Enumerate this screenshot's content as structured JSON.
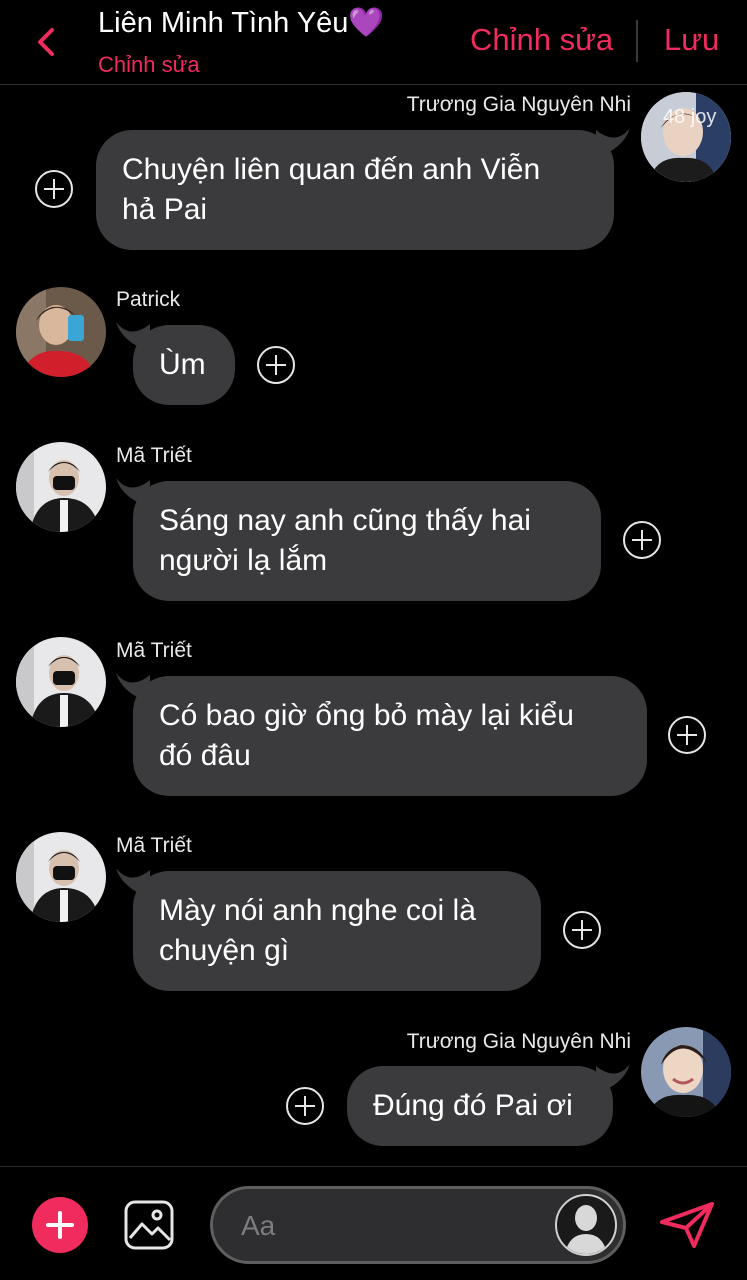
{
  "header": {
    "title": "Liên Minh Tình Yêu💜",
    "subtitle": "Chỉnh sửa",
    "edit_label": "Chỉnh sửa",
    "save_label": "Lưu"
  },
  "messages": [
    {
      "sender": "Trương Gia Nguyên Nhi",
      "side": "right",
      "lines": [
        "Chuyện liên quan đến anh Viễn",
        "hả Pai"
      ],
      "avatar_watermark": "48 joy"
    },
    {
      "sender": "Patrick",
      "side": "left",
      "lines": [
        "Ùm"
      ]
    },
    {
      "sender": "Mã Triết",
      "side": "left",
      "lines": [
        "Sáng nay anh cũng thấy hai",
        "người lạ lắm"
      ]
    },
    {
      "sender": "Mã Triết",
      "side": "left",
      "lines": [
        "Có bao giờ ổng bỏ mày lại kiểu",
        "đó đâu"
      ]
    },
    {
      "sender": "Mã Triết",
      "side": "left",
      "lines": [
        "Mày nói anh nghe coi là",
        "chuyện gì"
      ]
    },
    {
      "sender": "Trương Gia Nguyên Nhi",
      "side": "right",
      "lines": [
        "Đúng đó Pai ơi"
      ]
    }
  ],
  "composer": {
    "placeholder": "Aa"
  },
  "colors": {
    "accent": "#f02b5e",
    "bubble": "#3b3b3d",
    "background": "#000000"
  },
  "icons": [
    "chevron-left-icon",
    "plus-circle-icon",
    "image-icon",
    "send-icon",
    "add-icon"
  ]
}
